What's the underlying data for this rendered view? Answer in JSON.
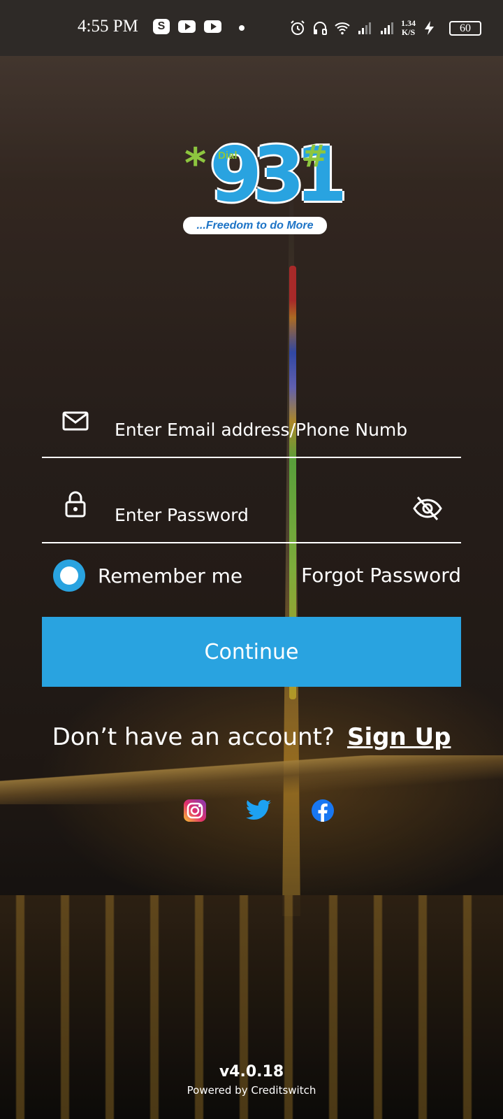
{
  "status_bar": {
    "time": "4:55 PM",
    "net_speed_value": "1.34",
    "net_speed_unit": "K/S",
    "battery": "60",
    "icons": [
      "skype-icon",
      "youtube-icon",
      "youtube-icon",
      "alarm-icon",
      "headphones-icon",
      "wifi-icon",
      "signal-icon",
      "signal-icon",
      "charging-icon"
    ]
  },
  "logo": {
    "dial": "Dial",
    "star": "*",
    "digits": "931",
    "hash": "#",
    "tagline": "...Freedom to do More",
    "colors": {
      "blue": "#29a3e0",
      "green": "#8dc63f",
      "tagline": "#1e74c6"
    }
  },
  "form": {
    "email_placeholder": "Enter Email address/Phone Number",
    "email_value": "",
    "password_placeholder": "Enter Password",
    "password_value": "",
    "remember_label": "Remember me",
    "forgot_label": "Forgot Password",
    "continue_label": "Continue"
  },
  "signup": {
    "prompt": "Don’t have an account?",
    "link": "Sign Up"
  },
  "socials": [
    "instagram-icon",
    "twitter-icon",
    "facebook-icon"
  ],
  "footer": {
    "version": "v4.0.18",
    "powered_by": "Powered by Creditswitch"
  },
  "colors": {
    "accent": "#29a3e0",
    "status_bar_bg": "#2e2a27"
  }
}
